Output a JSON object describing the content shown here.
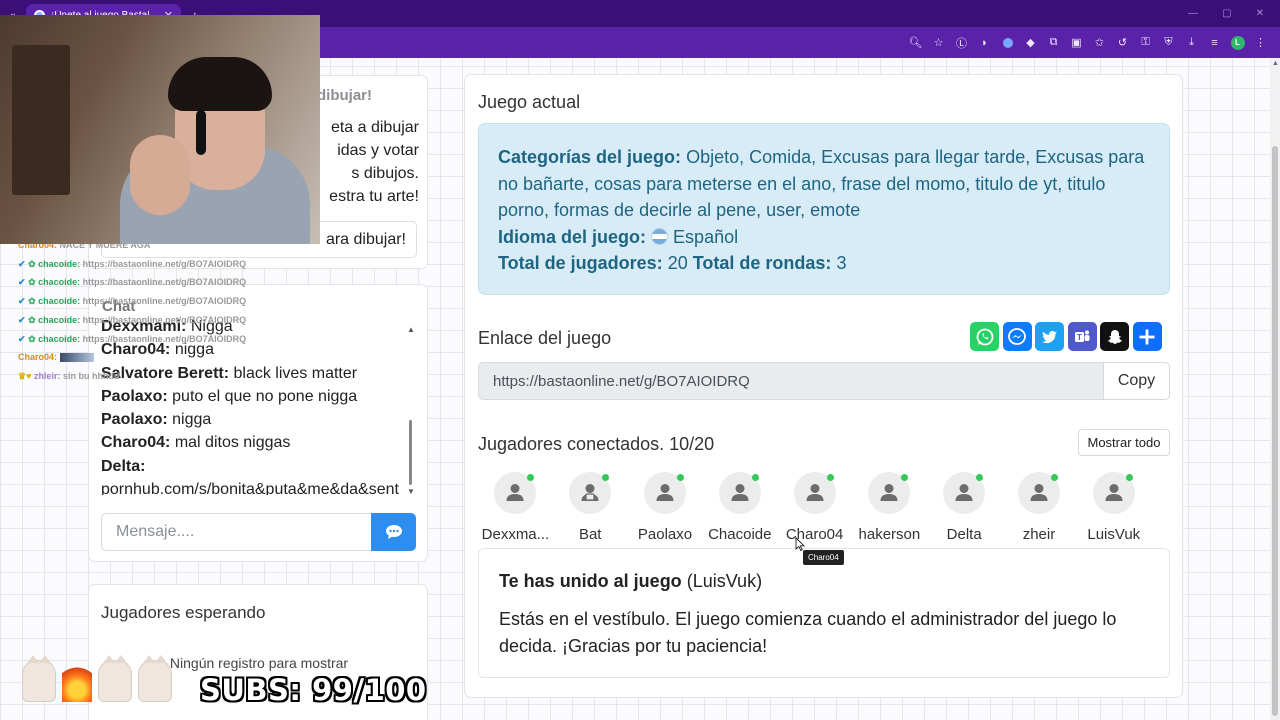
{
  "browser": {
    "tab_title": "¡Únete al juego Basta!",
    "new_tab": "+",
    "tab_close": "✕",
    "window_controls": [
      "—",
      "▢",
      "✕"
    ],
    "profile_initial": "L"
  },
  "draw_panel": {
    "heading": "dibujar!",
    "text_lines": [
      "eta a dibujar",
      "idas y votar",
      "s dibujos.",
      "estra tu arte!"
    ],
    "button_label": "ara dibujar!"
  },
  "chat": {
    "title": "Chat",
    "messages": [
      {
        "user": "Dexxmami:",
        "text": "Nigga"
      },
      {
        "user": "Charo04:",
        "text": "nigga"
      },
      {
        "user": "Salvatore Berett:",
        "text": "black lives matter"
      },
      {
        "user": "Paolaxo:",
        "text": "puto el que no pone nigga"
      },
      {
        "user": "Paolaxo:",
        "text": "nigga"
      },
      {
        "user": "Charo04:",
        "text": "mal ditos niggas"
      },
      {
        "user": "Delta:",
        "text": ""
      },
      {
        "user": "",
        "text": "pornhub.com/s/bonita&puta&me&da&sent"
      }
    ],
    "input_placeholder": "Mensaje...."
  },
  "waiting": {
    "title": "Jugadores esperando",
    "empty_text": "Ningún registro para mostrar"
  },
  "stream_chat": [
    {
      "user": "Charo04:",
      "msg": "NACE Y MUERE AGÁ",
      "color": "y"
    },
    {
      "user": "chacoide:",
      "msg": "https://bastaonline.net/g/BO7AIOIDRQ",
      "color": "g"
    },
    {
      "user": "chacoide:",
      "msg": "https://bastaonline.net/g/BO7AIOIDRQ",
      "color": "g"
    },
    {
      "user": "chacoide:",
      "msg": "https://bastaonline.net/g/BO7AIOIDRQ",
      "color": "g"
    },
    {
      "user": "chacoide:",
      "msg": "https://bastaonline.net/g/BO7AIOIDRQ",
      "color": "g"
    },
    {
      "user": "chacoide:",
      "msg": "https://bastaonline.net/g/BO7AIOIDRQ",
      "color": "g"
    },
    {
      "user": "Charo04:",
      "msg": "",
      "color": "y"
    },
    {
      "user": "zhleir:",
      "msg": "sin bu hhhdd",
      "color": "p"
    }
  ],
  "stream_overlay": {
    "subs_text": "SUBS: 99/100"
  },
  "game": {
    "title": "Juego actual",
    "categories_label": "Categorías del juego:",
    "categories": "Objeto, Comida, Excusas para llegar tarde, Excusas para no bañarte, cosas para meterse en el ano, frase del momo, titulo de yt, titulo porno, formas de decirle al pene, user, emote",
    "language_label": "Idioma del juego:",
    "language": "Español",
    "total_players_label": "Total de jugadores:",
    "total_players": "20",
    "total_rounds_label": "Total de rondas:",
    "total_rounds": "3",
    "link_title": "Enlace del juego",
    "link_url": "https://bastaonline.net/g/BO7AIOIDRQ",
    "copy_label": "Copy",
    "players_title": "Jugadores conectados. 10/20",
    "show_all_label": "Mostrar todo",
    "players": [
      {
        "name": "Dexxma...",
        "icon": "user-icon"
      },
      {
        "name": "Bat",
        "icon": "user-lock-icon"
      },
      {
        "name": "Paolaxo",
        "icon": "user-icon"
      },
      {
        "name": "Chacoide",
        "icon": "user-star-icon"
      },
      {
        "name": "Charo04",
        "icon": "user-icon"
      },
      {
        "name": "hakerson",
        "icon": "user-icon"
      },
      {
        "name": "Delta",
        "icon": "user-icon"
      },
      {
        "name": "zheir",
        "icon": "user-icon"
      },
      {
        "name": "LuisVuk",
        "icon": "user-icon"
      }
    ],
    "tooltip": "Charo04",
    "joined_title": "Te has unido al juego",
    "joined_user": "(LuisVuk)",
    "joined_text": "Estás en el vestíbulo. El juego comienza cuando el administrador del juego lo decida. ¡Gracias por tu paciencia!"
  },
  "share_buttons": [
    {
      "name": "whatsapp-share-button",
      "color": "#25d366",
      "glyph": "✆"
    },
    {
      "name": "messenger-share-button",
      "color": "#0a7cff",
      "glyph": "⚡"
    },
    {
      "name": "twitter-share-button",
      "color": "#1da1f2",
      "glyph": "✦"
    },
    {
      "name": "teams-share-button",
      "color": "#5059c9",
      "glyph": "T"
    },
    {
      "name": "snapchat-share-button",
      "color": "#111111",
      "glyph": "👻"
    },
    {
      "name": "share-more-button",
      "color": "#0d6efd",
      "glyph": "+"
    }
  ],
  "colors": {
    "accent": "#2d8ef0",
    "info_bg": "#d7ecf7",
    "info_text": "#1f6582",
    "online": "#34c759",
    "browser_frame": "#5a22a8"
  }
}
